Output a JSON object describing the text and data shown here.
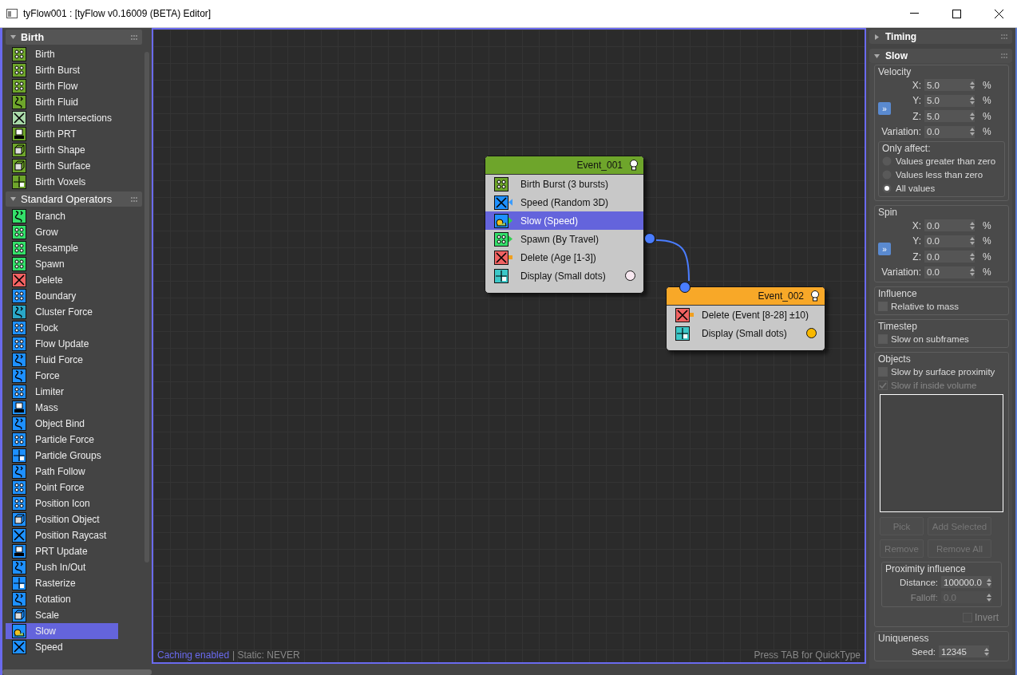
{
  "window": {
    "title": "tyFlow001 : [tyFlow v0.16009 (BETA) Editor]"
  },
  "left_panel": {
    "categories": [
      {
        "title": "Birth",
        "expanded": true,
        "items": [
          {
            "label": "Birth",
            "color": "#6ea52b",
            "kind": "dots",
            "selected": false
          },
          {
            "label": "Birth Burst",
            "color": "#6ea52b",
            "kind": "dots",
            "selected": false
          },
          {
            "label": "Birth Flow",
            "color": "#6ea52b",
            "kind": "dots",
            "selected": false
          },
          {
            "label": "Birth Fluid",
            "color": "#6ea52b",
            "kind": "curve",
            "selected": false
          },
          {
            "label": "Birth Intersections",
            "color": "#a8d8a8",
            "kind": "cross",
            "selected": false
          },
          {
            "label": "Birth PRT",
            "color": "#6ea52b",
            "kind": "disk",
            "selected": false
          },
          {
            "label": "Birth Shape",
            "color": "#6ea52b",
            "kind": "cube",
            "selected": false
          },
          {
            "label": "Birth Surface",
            "color": "#6ea52b",
            "kind": "cube",
            "selected": false
          },
          {
            "label": "Birth Voxels",
            "color": "#6ea52b",
            "kind": "grid",
            "selected": false
          }
        ]
      },
      {
        "title": "Standard Operators",
        "expanded": true,
        "items": [
          {
            "label": "Branch",
            "color": "#34e06a",
            "kind": "curve",
            "selected": false
          },
          {
            "label": "Grow",
            "color": "#34e06a",
            "kind": "dots",
            "selected": false
          },
          {
            "label": "Resample",
            "color": "#34e06a",
            "kind": "dots",
            "selected": false
          },
          {
            "label": "Spawn",
            "color": "#34e06a",
            "kind": "dots",
            "selected": false
          },
          {
            "label": "Delete",
            "color": "#f06262",
            "kind": "cross",
            "selected": false
          },
          {
            "label": "Boundary",
            "color": "#1e90ff",
            "kind": "dots",
            "selected": false
          },
          {
            "label": "Cluster Force",
            "color": "#2aa8c8",
            "kind": "curve",
            "selected": false
          },
          {
            "label": "Flock",
            "color": "#1e90ff",
            "kind": "dots",
            "selected": false
          },
          {
            "label": "Flow Update",
            "color": "#1e90ff",
            "kind": "dots",
            "selected": false
          },
          {
            "label": "Fluid Force",
            "color": "#1e90ff",
            "kind": "curve",
            "selected": false
          },
          {
            "label": "Force",
            "color": "#1e90ff",
            "kind": "curve",
            "selected": false
          },
          {
            "label": "Limiter",
            "color": "#1e90ff",
            "kind": "dots",
            "selected": false
          },
          {
            "label": "Mass",
            "color": "#1e90ff",
            "kind": "disk",
            "selected": false
          },
          {
            "label": "Object Bind",
            "color": "#1e90ff",
            "kind": "curve",
            "selected": false
          },
          {
            "label": "Particle Force",
            "color": "#1e90ff",
            "kind": "dots",
            "selected": false
          },
          {
            "label": "Particle Groups",
            "color": "#1e90ff",
            "kind": "grid",
            "selected": false
          },
          {
            "label": "Path Follow",
            "color": "#1e90ff",
            "kind": "curve",
            "selected": false
          },
          {
            "label": "Point Force",
            "color": "#1e90ff",
            "kind": "dots",
            "selected": false
          },
          {
            "label": "Position Icon",
            "color": "#1e90ff",
            "kind": "dots",
            "selected": false
          },
          {
            "label": "Position Object",
            "color": "#1e90ff",
            "kind": "cube",
            "selected": false
          },
          {
            "label": "Position Raycast",
            "color": "#1e90ff",
            "kind": "cross",
            "selected": false
          },
          {
            "label": "PRT Update",
            "color": "#1e90ff",
            "kind": "disk",
            "selected": false
          },
          {
            "label": "Push In/Out",
            "color": "#1e90ff",
            "kind": "curve",
            "selected": false
          },
          {
            "label": "Rasterize",
            "color": "#1e90ff",
            "kind": "grid",
            "selected": false
          },
          {
            "label": "Rotation",
            "color": "#1e90ff",
            "kind": "curve",
            "selected": false
          },
          {
            "label": "Scale",
            "color": "#1e90ff",
            "kind": "cube",
            "selected": false
          },
          {
            "label": "Slow",
            "color": "#1e90ff",
            "kind": "snail",
            "selected": true
          },
          {
            "label": "Speed",
            "color": "#1e90ff",
            "kind": "cross",
            "selected": false
          }
        ]
      }
    ]
  },
  "canvas": {
    "events": [
      {
        "title": "Event_001",
        "color": "#6ea52b",
        "operators": [
          {
            "label": "Birth Burst (3 bursts)",
            "color": "#6ea52b",
            "kind": "dots",
            "selected": false
          },
          {
            "label": "Speed (Random 3D)",
            "color": "#1e90ff",
            "kind": "cross",
            "selected": false,
            "pin": {
              "kind": "triangle-left",
              "color": "#3a9cff"
            }
          },
          {
            "label": "Slow (Speed)",
            "color": "#1e90ff",
            "kind": "snail",
            "selected": true,
            "pin": {
              "kind": "triangle-right",
              "color": "#30d050"
            }
          },
          {
            "label": "Spawn (By Travel)",
            "color": "#34e06a",
            "kind": "dots",
            "selected": false,
            "pin": {
              "kind": "triangle-right",
              "color": "#30d050"
            },
            "output_port": {
              "color": "#4a7dff"
            }
          },
          {
            "label": "Delete (Age [1-3])",
            "color": "#f06262",
            "kind": "cross",
            "selected": false,
            "pin": {
              "kind": "square",
              "color": "#f0a020"
            }
          },
          {
            "label": "Display (Small dots)",
            "color": "#3cc8c8",
            "kind": "grid",
            "selected": false,
            "swatch": {
              "color": "#f8e8f0"
            }
          }
        ]
      },
      {
        "title": "Event_002",
        "color": "#f8a828",
        "input_port": {
          "color": "#4a7dff"
        },
        "operators": [
          {
            "label": "Delete (Event [8-28] ±10)",
            "color": "#f06262",
            "kind": "cross",
            "selected": false,
            "pin": {
              "kind": "square",
              "color": "#f0a020"
            }
          },
          {
            "label": "Display (Small dots)",
            "color": "#3cc8c8",
            "kind": "grid",
            "selected": false,
            "swatch": {
              "color": "#f8b800"
            }
          }
        ]
      }
    ],
    "status": {
      "caching": "Caching enabled",
      "static": "| Static: NEVER",
      "hint": "Press TAB for QuickType"
    }
  },
  "right_panel": {
    "rollouts": [
      {
        "title": "Timing",
        "expanded": false
      },
      {
        "title": "Slow",
        "expanded": true
      }
    ],
    "velocity": {
      "title": "Velocity",
      "link": "»",
      "fields": [
        {
          "label": "X:",
          "value": "5.0",
          "unit": "%"
        },
        {
          "label": "Y:",
          "value": "5.0",
          "unit": "%"
        },
        {
          "label": "Z:",
          "value": "5.0",
          "unit": "%"
        },
        {
          "label": "Variation:",
          "value": "0.0",
          "unit": "%"
        }
      ],
      "only_affect": {
        "title": "Only affect:",
        "options": [
          {
            "label": "Values greater than zero",
            "selected": false
          },
          {
            "label": "Values less than zero",
            "selected": false
          },
          {
            "label": "All values",
            "selected": true
          }
        ]
      }
    },
    "spin": {
      "title": "Spin",
      "link": "»",
      "fields": [
        {
          "label": "X:",
          "value": "0.0",
          "unit": "%"
        },
        {
          "label": "Y:",
          "value": "0.0",
          "unit": "%"
        },
        {
          "label": "Z:",
          "value": "0.0",
          "unit": "%"
        },
        {
          "label": "Variation:",
          "value": "0.0",
          "unit": "%"
        }
      ]
    },
    "influence": {
      "title": "Influence",
      "checks": [
        {
          "label": "Relative to mass",
          "checked": false,
          "disabled": false
        }
      ]
    },
    "timestep": {
      "title": "Timestep",
      "checks": [
        {
          "label": "Slow on subframes",
          "checked": false,
          "disabled": false
        }
      ]
    },
    "objects": {
      "title": "Objects",
      "checks": [
        {
          "label": "Slow by surface proximity",
          "checked": false,
          "disabled": false
        },
        {
          "label": "Slow if inside volume",
          "checked": true,
          "disabled": true
        }
      ],
      "buttons": [
        {
          "label": "Pick",
          "disabled": true
        },
        {
          "label": "Add Selected",
          "disabled": true
        },
        {
          "label": "Remove",
          "disabled": true
        },
        {
          "label": "Remove All",
          "disabled": true
        }
      ],
      "proximity": {
        "title": "Proximity influence",
        "fields": [
          {
            "label": "Distance:",
            "value": "100000.0",
            "disabled": false
          },
          {
            "label": "Falloff:",
            "value": "0.0",
            "disabled": true
          }
        ]
      },
      "invert": {
        "label": "Invert",
        "checked": false,
        "disabled": true
      }
    },
    "uniqueness": {
      "title": "Uniqueness",
      "seed": {
        "label": "Seed:",
        "value": "12345"
      }
    }
  }
}
